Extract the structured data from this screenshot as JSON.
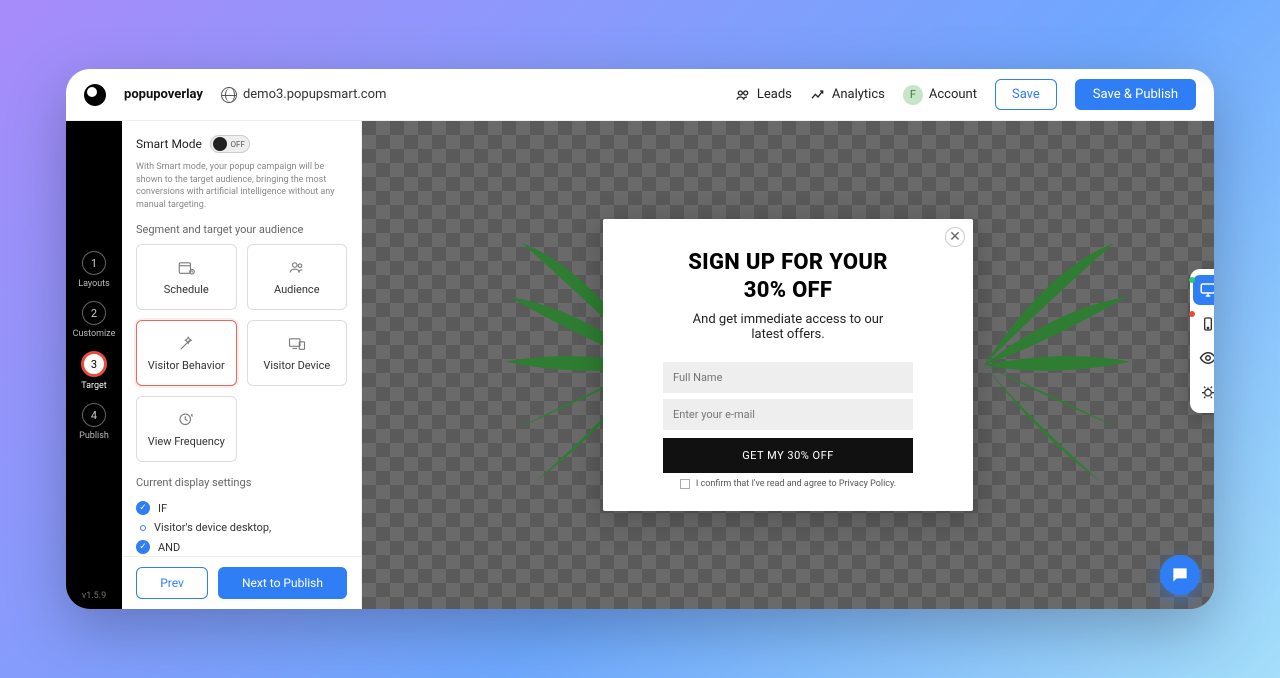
{
  "brand": {
    "name": "popupoverlay"
  },
  "domain": "demo3.popupsmart.com",
  "topnav": {
    "leads": "Leads",
    "analytics": "Analytics",
    "account": "Account",
    "account_initial": "F",
    "save": "Save",
    "publish": "Save & Publish"
  },
  "steps": [
    {
      "num": "1",
      "label": "Layouts"
    },
    {
      "num": "2",
      "label": "Customize"
    },
    {
      "num": "3",
      "label": "Target"
    },
    {
      "num": "4",
      "label": "Publish"
    }
  ],
  "version": "v1.5.9",
  "panel": {
    "smart_label": "Smart Mode",
    "toggle_text": "OFF",
    "help": "With Smart mode, your popup campaign will be shown to the target audience, bringing the most conversions with artificial intelligence without any manual targeting.",
    "segment_label": "Segment and target your audience",
    "tiles": {
      "schedule": "Schedule",
      "audience": "Audience",
      "behavior": "Visitor Behavior",
      "device": "Visitor Device",
      "frequency": "View Frequency"
    },
    "current_label": "Current display settings",
    "rules": {
      "if": "IF",
      "cond1": "Visitor's device desktop,",
      "and": "AND"
    },
    "prev": "Prev",
    "next": "Next to Publish"
  },
  "popup": {
    "title_l1": "SIGN UP FOR YOUR",
    "title_l2": "30% OFF",
    "sub_l1": "And get immediate access to our",
    "sub_l2": "latest offers.",
    "name_ph": "Full Name",
    "email_ph": "Enter your e-mail",
    "cta": "GET MY 30% OFF",
    "consent": "I confirm that I've read and agree to Privacy Policy."
  }
}
